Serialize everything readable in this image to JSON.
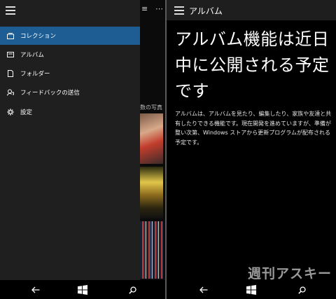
{
  "left_screen": {
    "background_app": {
      "top_glyphs": [
        "≡",
        "⋯"
      ],
      "section_label": "数の写真"
    },
    "nav_pane": {
      "items": [
        {
          "label": "コレクション",
          "icon": "collection-icon",
          "selected": true
        },
        {
          "label": "アルバム",
          "icon": "album-icon",
          "selected": false
        },
        {
          "label": "フォルダー",
          "icon": "folder-icon",
          "selected": false
        },
        {
          "label": "フィードバックの送信",
          "icon": "feedback-icon",
          "selected": false
        },
        {
          "label": "設定",
          "icon": "gear-icon",
          "selected": false
        }
      ]
    }
  },
  "right_screen": {
    "header": {
      "title": "アルバム"
    },
    "headline": "アルバム機能は近日中に公開される予定です",
    "body": "アルバムは、アルバムを見たり、編集したり、家族や友達と共有したりできる機能です。現在開発を進めていますが、準備が整い次第、Windows ストアから更新プログラムが配布される予定です。"
  },
  "watermark": "週刊アスキー",
  "colors": {
    "accent": "#1e5d93",
    "pane_bg": "#1f1f1f",
    "header_bg": "#1e1e1e",
    "background": "#000000"
  }
}
